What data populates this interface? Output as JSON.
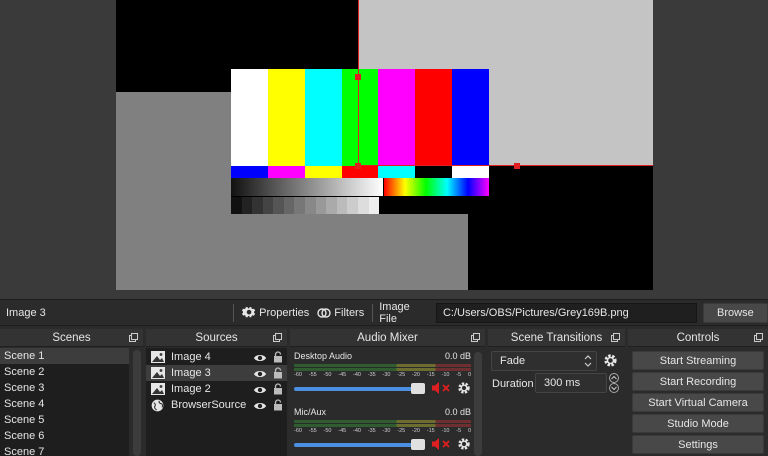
{
  "preview": {
    "gradient_steps": [
      "#111111",
      "#222222",
      "#333333",
      "#444444",
      "#555555",
      "#666666",
      "#777777",
      "#888888",
      "#999999",
      "#aaaaaa",
      "#bbbbbb",
      "#cccccc",
      "#dddddd",
      "#eeeeee"
    ],
    "bar_colors": [
      "#ffffff",
      "#ffff00",
      "#00ffff",
      "#00ff00",
      "#ff00ff",
      "#ff0000",
      "#0000ff"
    ],
    "selection_color": "#e02020"
  },
  "toolbar": {
    "selected_source": "Image 3",
    "properties_label": "Properties",
    "filters_label": "Filters",
    "image_file_label": "Image File",
    "image_file_value": "C:/Users/OBS/Pictures/Grey169B.png",
    "browse_label": "Browse"
  },
  "scenes": {
    "title": "Scenes",
    "items": [
      "Scene 1",
      "Scene 2",
      "Scene 3",
      "Scene 4",
      "Scene 5",
      "Scene 6",
      "Scene 7"
    ]
  },
  "sources": {
    "title": "Sources",
    "items": [
      {
        "name": "Image 4",
        "icon": "image-icon"
      },
      {
        "name": "Image 3",
        "icon": "image-icon"
      },
      {
        "name": "Image 2",
        "icon": "image-icon"
      },
      {
        "name": "BrowserSource",
        "icon": "globe-icon"
      }
    ]
  },
  "audio": {
    "title": "Audio Mixer",
    "ticks": [
      "-60",
      "-55",
      "-50",
      "-45",
      "-40",
      "-35",
      "-30",
      "-25",
      "-20",
      "-15",
      "-10",
      "-5",
      "0"
    ],
    "channels": [
      {
        "name": "Desktop Audio",
        "level": "0.0 dB"
      },
      {
        "name": "Mic/Aux",
        "level": "0.0 dB"
      }
    ]
  },
  "transitions": {
    "title": "Scene Transitions",
    "selected": "Fade",
    "duration_label": "Duration",
    "duration_value": "300 ms"
  },
  "controls": {
    "title": "Controls",
    "buttons": [
      "Start Streaming",
      "Start Recording",
      "Start Virtual Camera",
      "Studio Mode",
      "Settings"
    ]
  },
  "colors": {
    "accent": "#4a8fe0",
    "mute_red": "#e02020"
  }
}
